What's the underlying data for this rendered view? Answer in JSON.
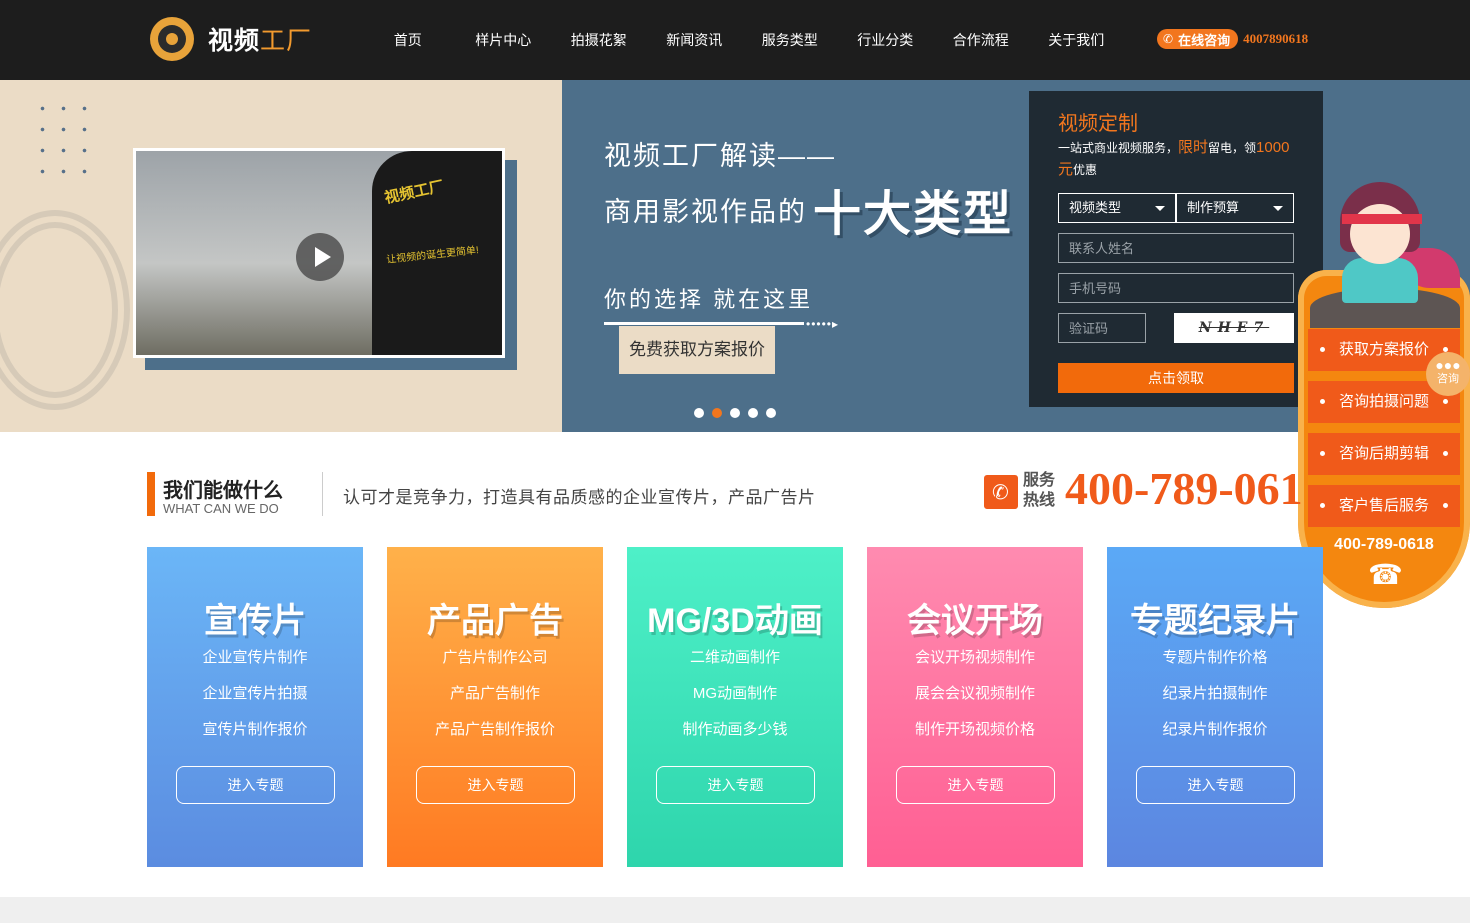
{
  "header": {
    "logo_main": "视频",
    "logo_accent": "工厂",
    "nav": [
      "首页",
      "样片中心",
      "拍摄花絮",
      "新闻资讯",
      "服务类型",
      "行业分类",
      "合作流程",
      "关于我们"
    ],
    "consult_label": "在线咨询",
    "consult_phone": "4007890618",
    "accent_color": "#f2761e"
  },
  "banner": {
    "video_person_text": "视频工厂",
    "video_person_sub": "让视频的诞生更简单!",
    "title_line1": "视频工厂解读——",
    "title_line2_prefix": "商用影视作品的",
    "title_line2_big": "十大类型",
    "subtitle": "你的选择 就在这里",
    "arrow": "•••••▸",
    "cta": "免费获取方案报价",
    "slides": 5,
    "active_slide": 2
  },
  "form": {
    "title": "视频定制",
    "desc_prefix": "一站式商业视频服务，",
    "desc_hl1": "限时",
    "desc_mid": "留电，领",
    "desc_hl2": "1000元",
    "desc_suffix": "优惠",
    "select_type": "视频类型",
    "select_budget": "制作预算",
    "name_placeholder": "联系人姓名",
    "phone_placeholder": "手机号码",
    "code_placeholder": "验证码",
    "captcha_text": "NHE7",
    "submit": "点击领取"
  },
  "float_panel": {
    "items": [
      "获取方案报价",
      "咨询拍摄问题",
      "咨询后期剪辑",
      "客户售后服务"
    ],
    "phone": "400-789-0618",
    "phone_icon": "☎",
    "consult_bubble": "咨询"
  },
  "section": {
    "title": "我们能做什么",
    "subtitle": "WHAT CAN WE DO",
    "desc": "认可才是竞争力，打造具有品质感的企业宣传片，产品广告片",
    "hotline_label1": "服务",
    "hotline_label2": "热线",
    "hotline_number": "400-789-061"
  },
  "cards": [
    {
      "title": "宣传片",
      "links": [
        "企业宣传片制作",
        "企业宣传片拍摄",
        "宣传片制作报价"
      ],
      "button": "进入专题",
      "color_top": "#6bb6f7",
      "color_bottom": "#5b8ce0"
    },
    {
      "title": "产品广告",
      "links": [
        "广告片制作公司",
        "产品广告制作",
        "产品广告制作报价"
      ],
      "button": "进入专题",
      "color_top": "#ffb14a",
      "color_bottom": "#ff7a22"
    },
    {
      "title": "MG/3D动画",
      "links": [
        "二维动画制作",
        "MG动画制作",
        "制作动画多少钱"
      ],
      "button": "进入专题",
      "color_top": "#4ef0c8",
      "color_bottom": "#2ed5ac"
    },
    {
      "title": "会议开场",
      "links": [
        "会议开场视频制作",
        "展会会议视频制作",
        "制作开场视频价格"
      ],
      "button": "进入专题",
      "color_top": "#ff8bb0",
      "color_bottom": "#ff5f93"
    },
    {
      "title": "专题纪录片",
      "links": [
        "专题片制作价格",
        "纪录片拍摄制作",
        "纪录片制作报价"
      ],
      "button": "进入专题",
      "color_top": "#5ba9f6",
      "color_bottom": "#5c86e0"
    }
  ]
}
